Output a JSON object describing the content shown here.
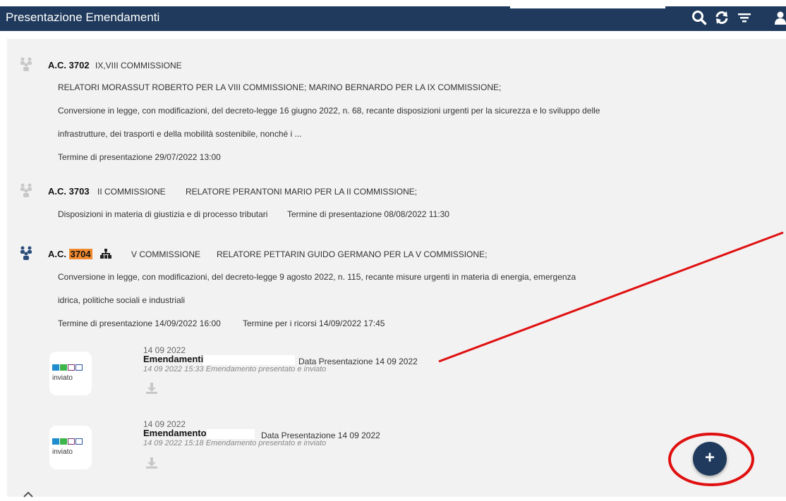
{
  "header": {
    "title": "Presentazione Emendamenti",
    "icons": [
      "search-icon",
      "refresh-icon",
      "filter-icon",
      "user-icon"
    ],
    "background": "#1f3a5c"
  },
  "acts": [
    {
      "code_prefix": "A.C.",
      "number": "3702",
      "commission": "IX,VIII COMMISSIONE",
      "rapporteurs": "RELATORI MORASSUT ROBERTO PER LA VIII COMMISSIONE; MARINO BERNARDO PER LA IX COMMISSIONE;",
      "description_line1": "Conversione in legge, con modificazioni, del decreto-legge 16 giugno 2022, n. 68, recante disposizioni urgenti per la sicurezza e lo sviluppo delle",
      "description_line2": "infrastrutture, dei trasporti e della mobilità sostenibile, nonché i ...",
      "deadline": "Termine di presentazione 29/07/2022 13:00"
    },
    {
      "code_prefix": "A.C.",
      "number": "3703",
      "commission": "II COMMISSIONE",
      "rapporteurs": "RELATORE PERANTONI MARIO PER LA II COMMISSIONE;",
      "description": "Disposizioni in materia di giustizia e di processo tributari",
      "deadline": "Termine di presentazione 08/08/2022 11:30"
    },
    {
      "code_prefix": "A.C.",
      "number": "3704",
      "commission": "V COMMISSIONE",
      "rapporteurs": "RELATORE PETTARIN GUIDO GERMANO PER LA V COMMISSIONE;",
      "description_line1": "Conversione in legge, con modificazioni, del decreto-legge 9 agosto 2022, n. 115, recante misure urgenti in materia di energia, emergenza",
      "description_line2": "idrica, politiche sociali e industriali",
      "deadline": "Termine di presentazione 14/09/2022 16:00",
      "appeal_deadline": "Termine per i ricorsi 14/09/2022 17:45",
      "highlight_color": "#f28a2e"
    }
  ],
  "documents": [
    {
      "status": "inviato",
      "date": "14 09 2022",
      "title": "Emendamenti",
      "presentation_date": "Data Presentazione 14 09 2022",
      "log": "14 09 2022 15:33 Emendamento presentato e inviato",
      "icon": "download-icon"
    },
    {
      "status": "inviato",
      "date": "14 09 2022",
      "title": "Emendamento",
      "presentation_date": "Data Presentazione 14 09 2022",
      "log": "14 09 2022 15:18 Emendamento presentato e inviato",
      "icon": "download-icon"
    }
  ],
  "fab": {
    "label": "+"
  },
  "annotation_color": "#e01010"
}
